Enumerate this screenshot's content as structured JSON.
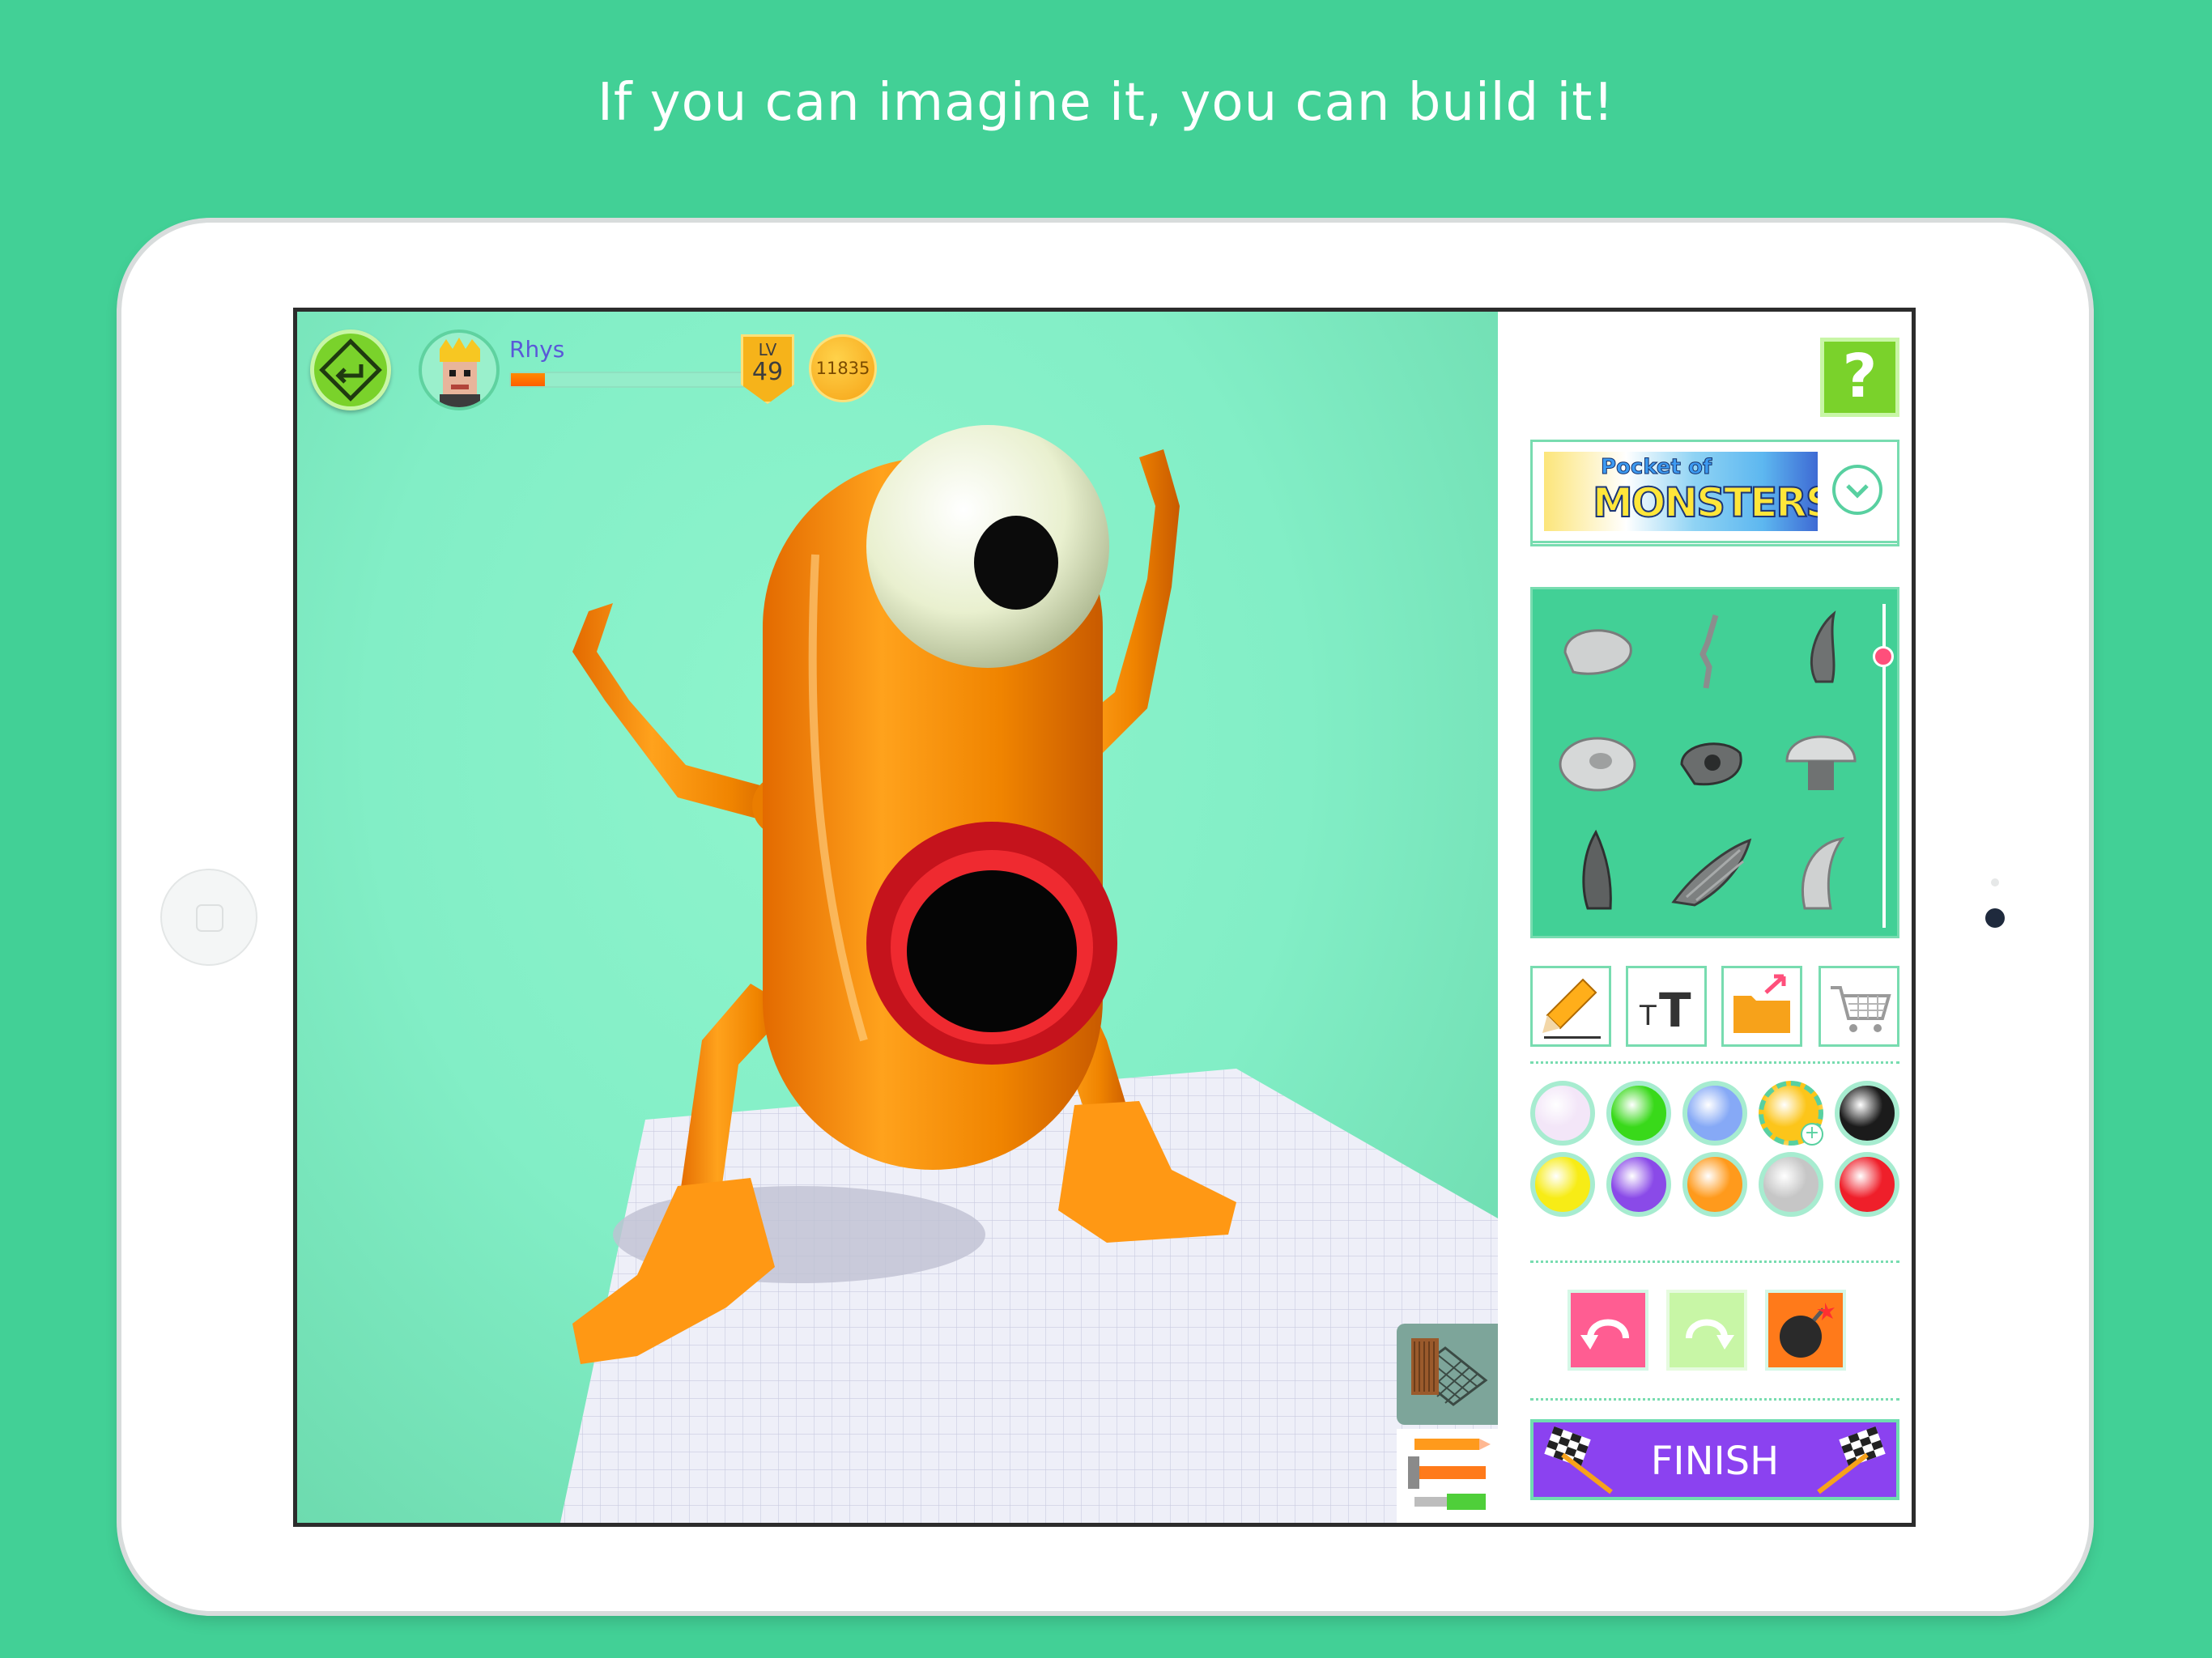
{
  "tagline": "If you can imagine it, you can build it!",
  "player": {
    "name": "Rhys",
    "level_label": "LV",
    "level": "49",
    "coins": "11835",
    "xp_fraction": 0.14
  },
  "pack": {
    "logo_line1": "Pocket of",
    "logo_line2": "MONSTERS"
  },
  "parts_scroll_fraction": 0.14,
  "parts": [
    "rock-part-icon",
    "twig-part-icon",
    "horn-part-icon",
    "blob-part-icon",
    "snout-part-icon",
    "dome-part-icon",
    "fin-part-icon",
    "wing-part-icon",
    "claw-part-icon"
  ],
  "tools": [
    "pencil-icon",
    "text-size-icon",
    "folder-icon",
    "cart-icon"
  ],
  "colors": {
    "swatches": [
      "#f3e6f8",
      "#39d91a",
      "#86a9f6",
      "#fcc51a",
      "#1b1b1b",
      "#f7ec16",
      "#8a4ae8",
      "#ff9a1c",
      "#c6c6c6",
      "#ef1f2a"
    ],
    "selected_index": 3,
    "background": "#42d096",
    "accent_green": "#7ad22b",
    "finish_purple": "#8b42f0",
    "undo_pink": "#ff5d92",
    "bomb_orange": "#ff7a1a"
  },
  "actions": {
    "finish_label": "FINISH"
  }
}
